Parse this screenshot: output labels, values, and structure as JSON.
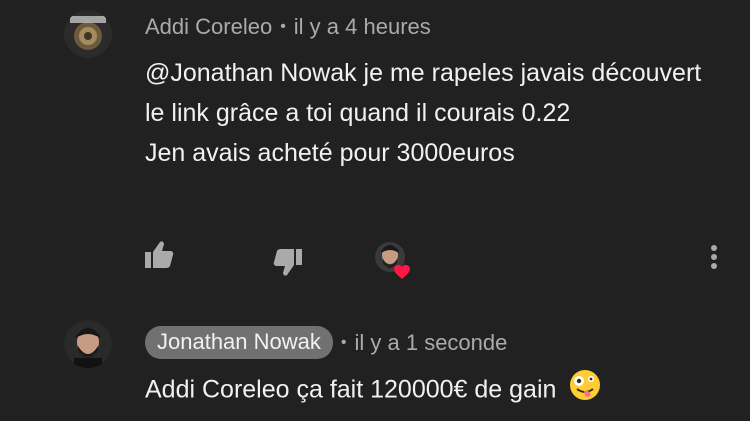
{
  "comments": [
    {
      "author": "Addi Coreleo",
      "separator": "•",
      "time": "il y a 4 heures",
      "lines": [
        "@Jonathan Nowak je me rapeles javais découvert le link grâce a toi quand il courais 0.22",
        "Jen avais acheté pour 3000euros"
      ],
      "actions": {
        "like_icon": "thumb-up-icon",
        "dislike_icon": "thumb-down-icon",
        "creator_heart": "creator-heart-icon",
        "menu_icon": "more-vert-icon"
      }
    },
    {
      "author": "Jonathan Nowak",
      "separator": "•",
      "time": "il y a 1 seconde",
      "text": "Addi Coreleo ça fait 120000€ de gain",
      "emoji": "zany-face-emoji"
    }
  ],
  "colors": {
    "background": "#212121",
    "text_primary": "#f1f1f1",
    "text_secondary": "#aaaaaa",
    "author_chip": "#717171",
    "heart": "#ff1744"
  }
}
